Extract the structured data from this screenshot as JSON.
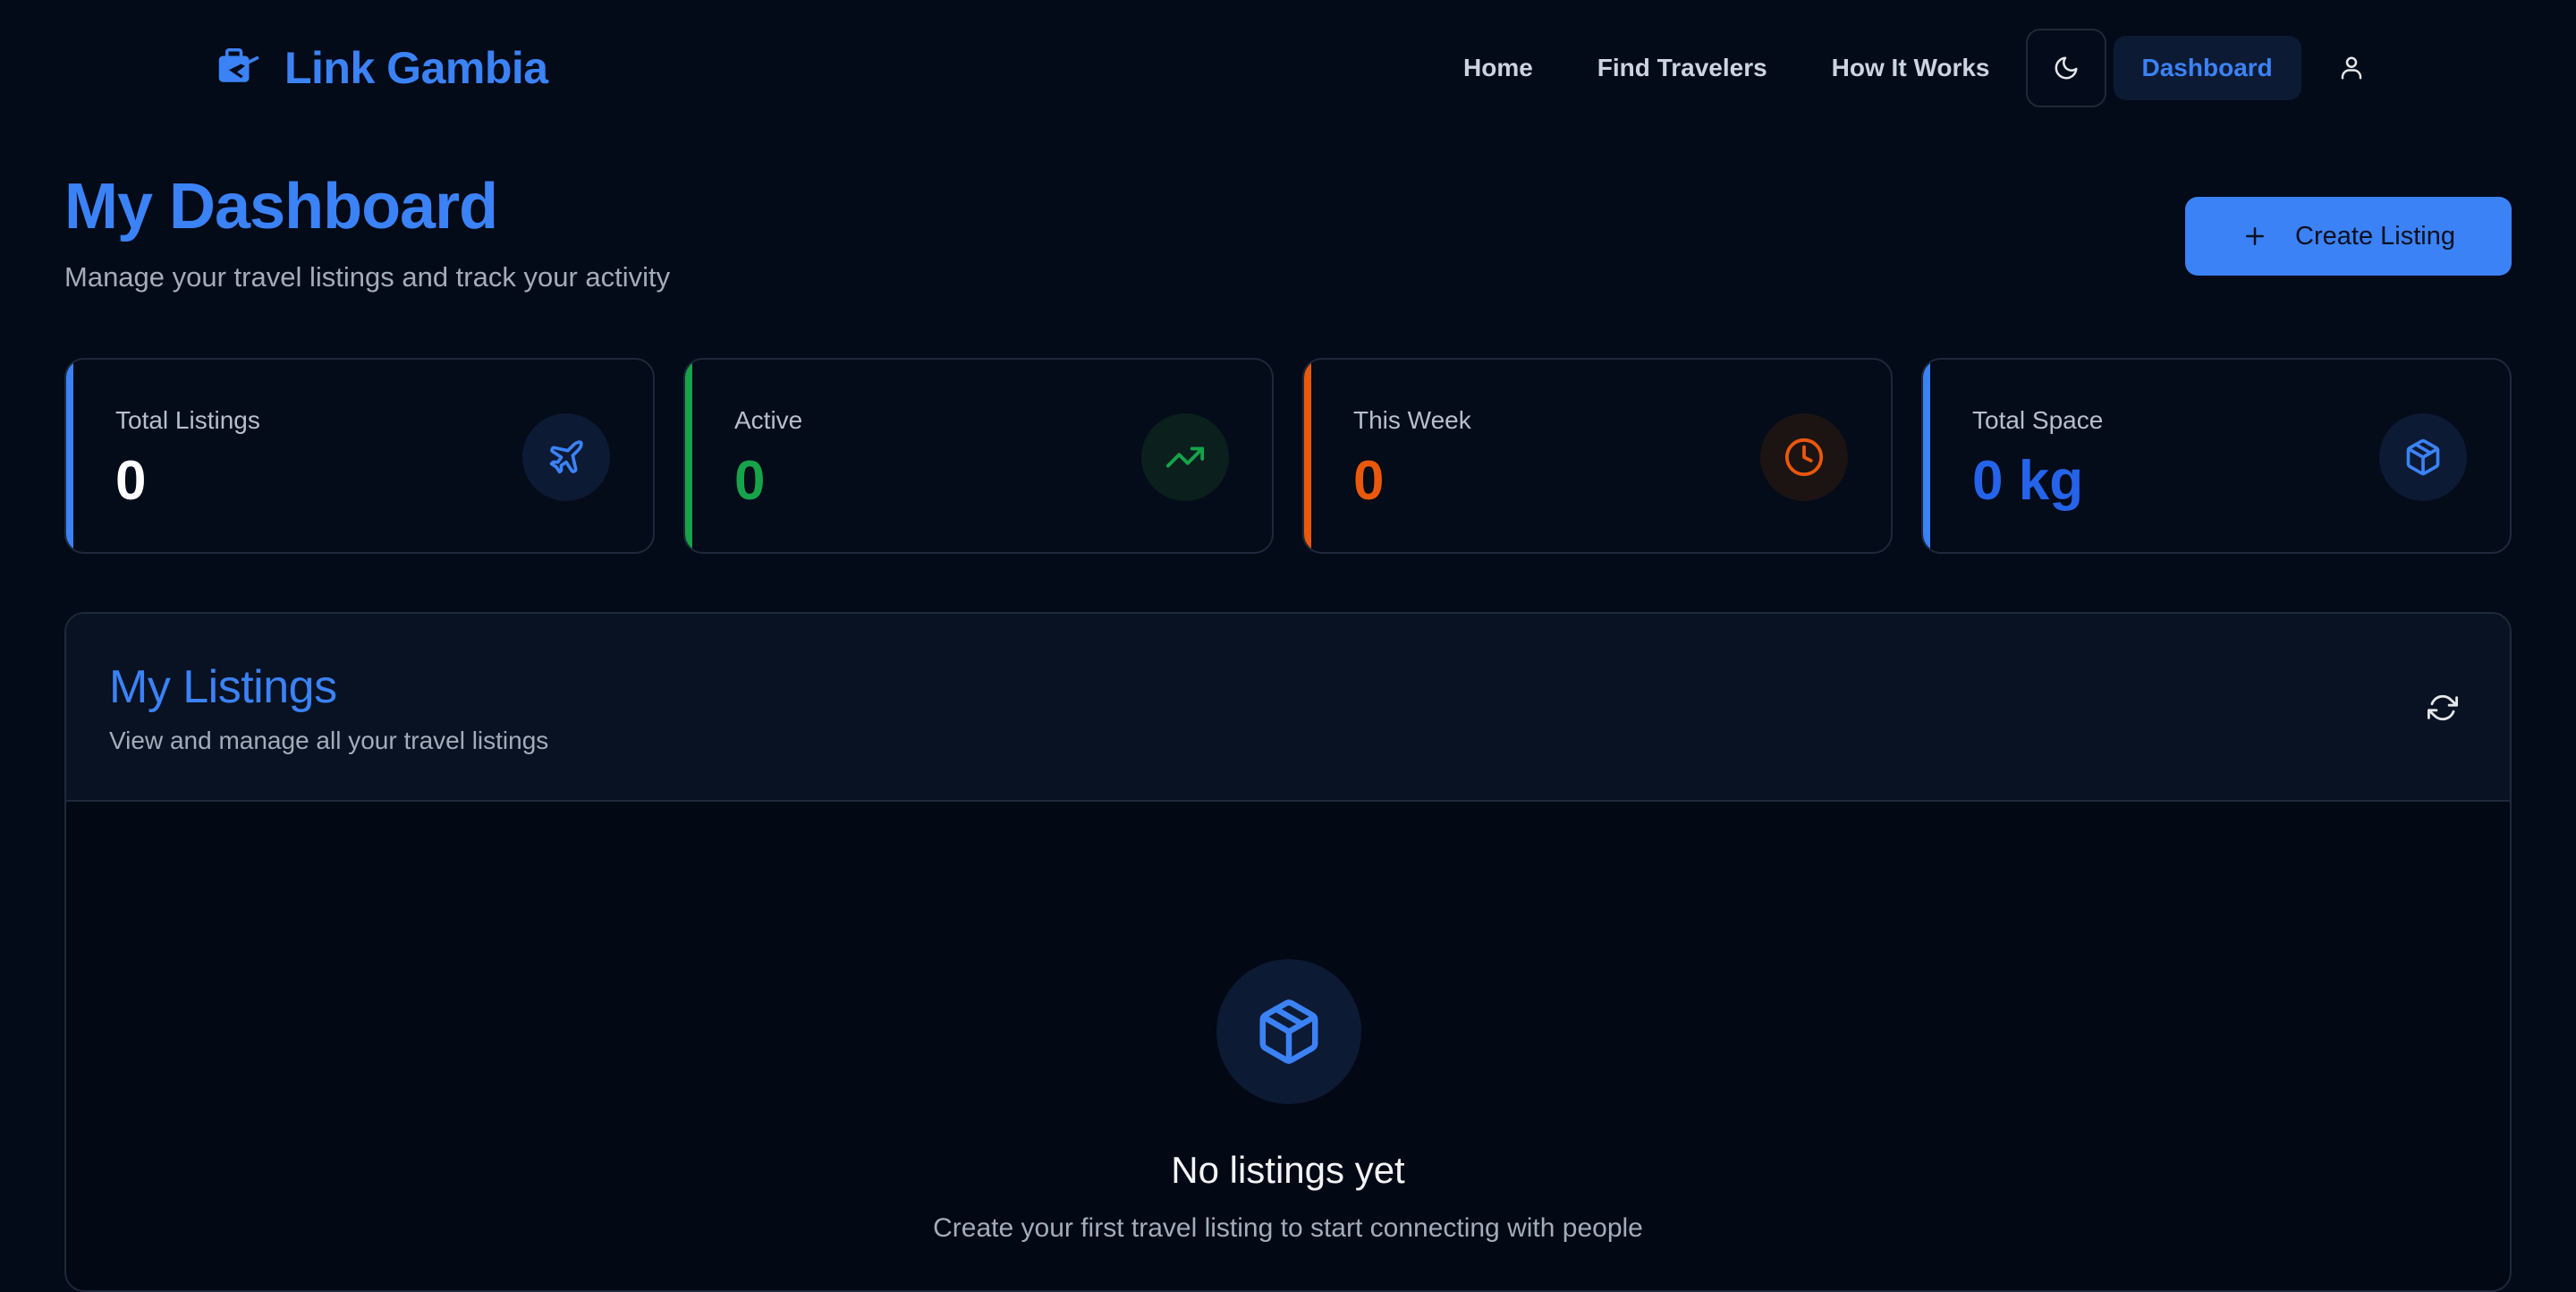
{
  "brand": {
    "name": "Link Gambia",
    "logo_icon": "luggage-plane-icon",
    "accent_color": "#3b82f6"
  },
  "nav": {
    "links": [
      "Home",
      "Find Travelers",
      "How It Works"
    ],
    "theme_toggle_icon": "moon-icon",
    "dashboard_label": "Dashboard",
    "user_icon": "user-icon"
  },
  "page": {
    "title": "My Dashboard",
    "subtitle": "Manage your travel listings and track your activity",
    "create_button_label": "Create Listing"
  },
  "stats": [
    {
      "label": "Total Listings",
      "value": "0",
      "icon": "plane-icon",
      "color": "#3b82f6",
      "value_color": "#ffffff"
    },
    {
      "label": "Active",
      "value": "0",
      "icon": "trending-up-icon",
      "color": "#16a34a",
      "value_color": "#16a34a"
    },
    {
      "label": "This Week",
      "value": "0",
      "icon": "clock-icon",
      "color": "#ea580c",
      "value_color": "#ea580c"
    },
    {
      "label": "Total Space",
      "value": "0 kg",
      "icon": "package-icon",
      "color": "#3b82f6",
      "value_color": "#2563eb"
    }
  ],
  "listings": {
    "title": "My Listings",
    "subtitle": "View and manage all your travel listings",
    "refresh_icon": "refresh-icon",
    "empty_icon": "package-icon",
    "empty_title": "No listings yet",
    "empty_text": "Create your first travel listing to start connecting with people"
  }
}
